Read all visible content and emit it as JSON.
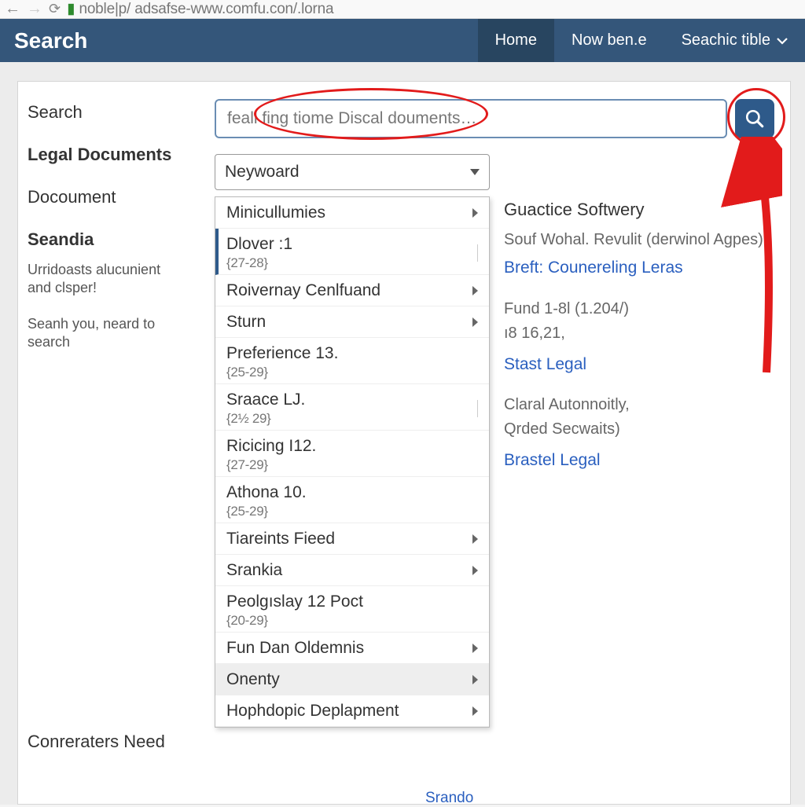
{
  "chrome": {
    "url_prefix": "noble|p",
    "url_rest": "/ adsafse-www.comfu.con/.lorna"
  },
  "topbar": {
    "brand": "Search",
    "home": "Home",
    "now": "Now ben.e",
    "menu": "Seachic tible"
  },
  "left": {
    "search_label": "Search",
    "legal_docs": "Legal Documents",
    "document": "Docoument",
    "seandia": "Seandia",
    "hint1a": "Urridoasts alucunient",
    "hint1b": "and clsper!",
    "hint2a": "Seanh you, neard to",
    "hint2b": "search",
    "corner": "Conreraters Need"
  },
  "search": {
    "value": "feall fing tiome Discal douments…"
  },
  "keyword": {
    "selected": "Neywoard"
  },
  "dropdown": [
    {
      "label": "Minicullumies",
      "sub": "",
      "caret": true
    },
    {
      "label": "Dlover :1",
      "sub": "{27-28}",
      "caret": false,
      "selected": true,
      "tick": true
    },
    {
      "label": "Roivernay Cenlfuand",
      "sub": "",
      "caret": true
    },
    {
      "label": "Sturn",
      "sub": "",
      "caret": true
    },
    {
      "label": "Preferience 13.",
      "sub": "{25-29}",
      "caret": false
    },
    {
      "label": "Sraace LJ.",
      "sub": "{2½ 29}",
      "caret": false,
      "tick": true
    },
    {
      "label": "Ricicing I12.",
      "sub": "{27-29}",
      "caret": false
    },
    {
      "label": "Athona 10.",
      "sub": "{25-29}",
      "caret": false
    },
    {
      "label": "Tiareints Fieed",
      "sub": "",
      "caret": true
    },
    {
      "label": "Srankia",
      "sub": "",
      "caret": true
    },
    {
      "label": "Peolgıslay 12 Poct",
      "sub": "{20-29}",
      "caret": false
    },
    {
      "label": "Fun Dan Oldemnis",
      "sub": "",
      "caret": true
    },
    {
      "label": "Onenty",
      "sub": "",
      "caret": true,
      "hovered": true
    },
    {
      "label": "Hophdopic Deplapment",
      "sub": "",
      "caret": true
    }
  ],
  "results": {
    "r0_title": "Guactice Softwery",
    "r0_line": "Souf Wohal. Revulit (derwinol Agpes)",
    "r0_link": "Breft: Counereling Leras",
    "r1_line1": "Fund 1-8l (1.204/)",
    "r1_line2": "ı8 16,21,",
    "r1_link": "Stast Legal",
    "r2_line1": "Claral Autonnoitly,",
    "r2_line2": "Qrded Secwaits)",
    "r2_link": "Brastel Legal"
  },
  "bottom_link": "Srando"
}
